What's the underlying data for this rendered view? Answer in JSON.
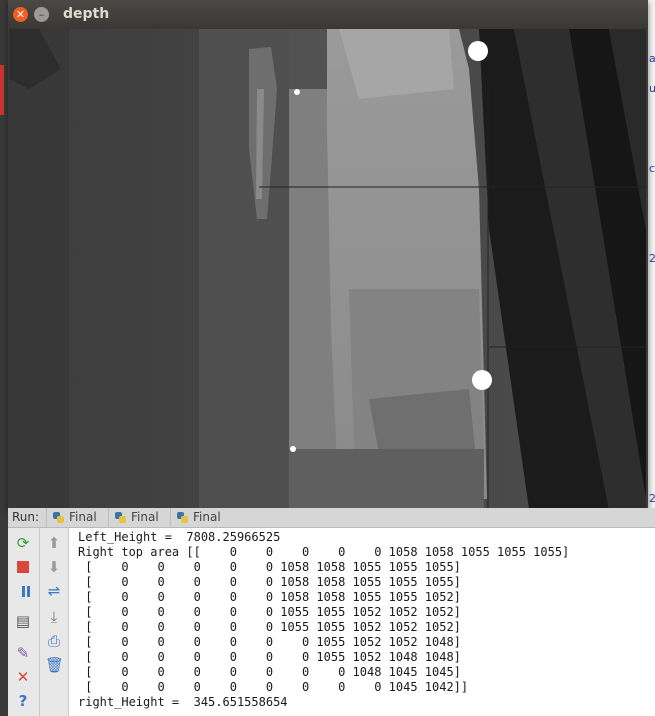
{
  "window": {
    "title": "depth"
  },
  "run_panel": {
    "run_label": "Run:",
    "tabs": [
      {
        "label": "Final"
      },
      {
        "label": "Final"
      },
      {
        "label": "Final"
      }
    ]
  },
  "console_lines": [
    "Left_Height =  7808.25966525",
    "Right top area [[    0    0    0    0    0 1058 1058 1055 1055 1055]",
    " [    0    0    0    0    0 1058 1058 1055 1055 1055]",
    " [    0    0    0    0    0 1058 1058 1055 1055 1055]",
    " [    0    0    0    0    0 1058 1058 1055 1055 1052]",
    " [    0    0    0    0    0 1055 1055 1052 1052 1052]",
    " [    0    0    0    0    0 1055 1055 1052 1052 1052]",
    " [    0    0    0    0    0    0 1055 1052 1052 1048]",
    " [    0    0    0    0    0    0 1055 1052 1048 1048]",
    " [    0    0    0    0    0    0    0 1048 1045 1045]",
    " [    0    0    0    0    0    0    0    0 1045 1042]]",
    "right_Height =  345.651558654"
  ],
  "icons": {
    "close": "close-icon",
    "minimize": "minimize-icon",
    "rerun": "rerun-icon",
    "stop": "stop-icon",
    "pause": "pause-icon",
    "layout": "layout-icon",
    "pin": "pin-icon",
    "close_run": "close-run-icon",
    "help": "help-icon",
    "up": "arrow-up-icon",
    "down": "arrow-down-icon",
    "soft_wrap": "soft-wrap-icon",
    "scroll_end": "scroll-to-end-icon",
    "print": "print-icon",
    "trash": "trash-icon"
  },
  "colors": {
    "stop": "#d9463a",
    "rerun": "#3c9b3c",
    "pause": "#3b78c4",
    "close_btn": "#f15d22"
  }
}
